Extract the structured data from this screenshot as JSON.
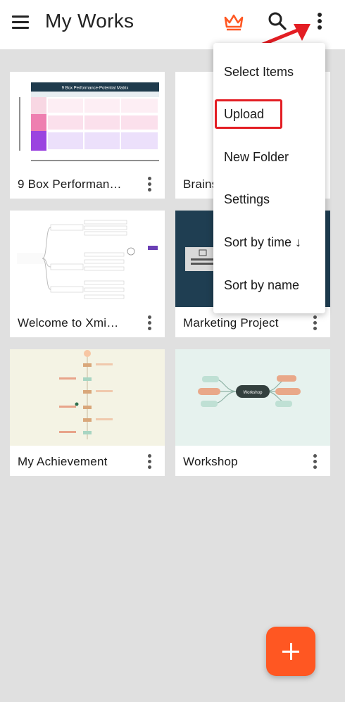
{
  "app_bar": {
    "title": "My Works",
    "icons": [
      "menu-icon",
      "crown-icon",
      "search-icon",
      "more-vert-icon"
    ]
  },
  "cards": [
    {
      "name": "9 Box Performan…",
      "thumb_title": "9 Box Performance-Potential Matrix"
    },
    {
      "name": "Brains…"
    },
    {
      "name": "Welcome to Xmi…"
    },
    {
      "name": "Marketing Project"
    },
    {
      "name": "My Achievement"
    },
    {
      "name": "Workshop",
      "thumb_title": "Workshop"
    }
  ],
  "dropdown": {
    "items": [
      {
        "label": "Select Items"
      },
      {
        "label": "Upload"
      },
      {
        "label": "New Folder"
      },
      {
        "label": "Settings"
      },
      {
        "label": "Sort by time ↓"
      },
      {
        "label": "Sort by name"
      }
    ],
    "highlight_color": "#e31e24"
  },
  "fab": {
    "icon": "plus-icon",
    "color": "#ff5722"
  },
  "colors": {
    "crown": "#ff5722",
    "arrow": "#e31e24",
    "background": "#e0e0e0"
  }
}
